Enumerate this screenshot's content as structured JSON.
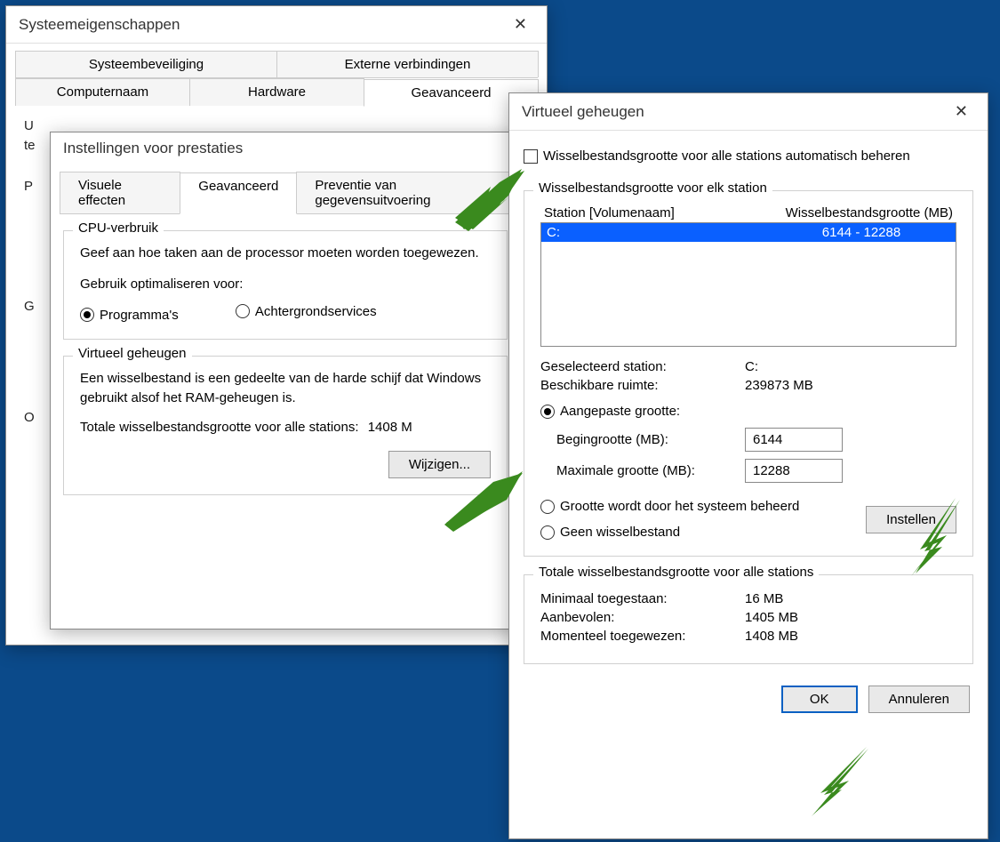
{
  "w1": {
    "title": "Systeemeigenschappen",
    "tabs_top": [
      "Systeembeveiliging",
      "Externe verbindingen"
    ],
    "tabs_bot": [
      "Computernaam",
      "Hardware",
      "Geavanceerd"
    ],
    "active_tab": "Geavanceerd",
    "body_line1": "U",
    "body_line2": "te",
    "side_letters": [
      "P",
      "G",
      "O"
    ]
  },
  "w2": {
    "title": "Instellingen voor prestaties",
    "tabs": [
      "Visuele effecten",
      "Geavanceerd",
      "Preventie van gegevensuitvoering"
    ],
    "active_tab": "Geavanceerd",
    "cpu_title": "CPU-verbruik",
    "cpu_desc": "Geef aan hoe taken aan de processor moeten worden toegewezen.",
    "cpu_label": "Gebruik optimaliseren voor:",
    "cpu_opt1": "Programma's",
    "cpu_opt2": "Achtergrondservices",
    "vm_title": "Virtueel geheugen",
    "vm_desc": "Een wisselbestand is een gedeelte van de harde schijf dat Windows gebruikt alsof het RAM-geheugen is.",
    "vm_total_label": "Totale wisselbestandsgrootte voor alle stations:",
    "vm_total_value": "1408 M",
    "vm_change": "Wijzigen..."
  },
  "w3": {
    "title": "Virtueel geheugen",
    "auto_label": "Wisselbestandsgrootte voor alle stations automatisch beheren",
    "per_station_title": "Wisselbestandsgrootte voor elk station",
    "col_drive": "Station [Volumenaam]",
    "col_size": "Wisselbestandsgrootte (MB)",
    "drives": [
      {
        "name": "C:",
        "size": "6144 - 12288",
        "selected": true
      }
    ],
    "selected_station_label": "Geselecteerd station:",
    "selected_station_value": "C:",
    "available_label": "Beschikbare ruimte:",
    "available_value": "239873 MB",
    "custom_label": "Aangepaste grootte:",
    "initial_label": "Begingrootte (MB):",
    "initial_value": "6144",
    "max_label": "Maximale grootte (MB):",
    "max_value": "12288",
    "system_managed_label": "Grootte wordt door het systeem beheerd",
    "no_pagefile_label": "Geen wisselbestand",
    "set_button": "Instellen",
    "totals_title": "Totale wisselbestandsgrootte voor alle stations",
    "min_label": "Minimaal toegestaan:",
    "min_value": "16 MB",
    "rec_label": "Aanbevolen:",
    "rec_value": "1405 MB",
    "cur_label": "Momenteel toegewezen:",
    "cur_value": "1408 MB",
    "ok": "OK",
    "cancel": "Annuleren"
  }
}
